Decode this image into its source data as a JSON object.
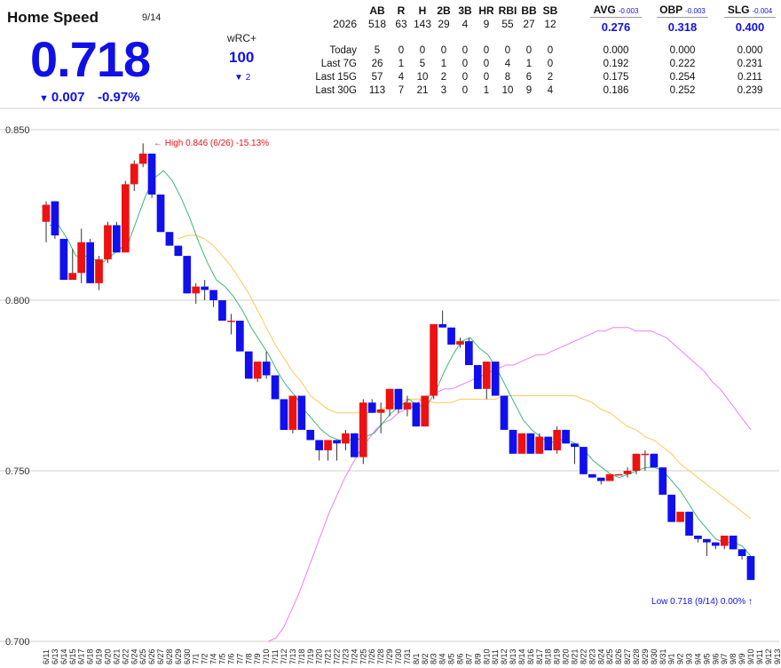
{
  "header": {
    "title": "Home Speed",
    "date": "9/14",
    "value": "0.718",
    "change": "0.007",
    "change_pct": "-0.97%",
    "wrc_label": "wRC+",
    "wrc_value": "100",
    "wrc_change": "2",
    "down_color": "#1010e6"
  },
  "stats": {
    "columns": [
      "AB",
      "R",
      "H",
      "2B",
      "3B",
      "HR",
      "RBI",
      "BB",
      "SB"
    ],
    "season_label": "2026",
    "season": [
      "518",
      "63",
      "143",
      "29",
      "4",
      "9",
      "55",
      "27",
      "12"
    ],
    "rows": [
      {
        "label": "Today",
        "values": [
          "5",
          "0",
          "0",
          "0",
          "0",
          "0",
          "0",
          "0",
          "0"
        ]
      },
      {
        "label": "Last 7G",
        "values": [
          "26",
          "1",
          "5",
          "1",
          "0",
          "0",
          "4",
          "1",
          "0"
        ]
      },
      {
        "label": "Last 15G",
        "values": [
          "57",
          "4",
          "10",
          "2",
          "0",
          "0",
          "8",
          "6",
          "2"
        ]
      },
      {
        "label": "Last 30G",
        "values": [
          "113",
          "7",
          "21",
          "3",
          "0",
          "1",
          "10",
          "9",
          "4"
        ]
      }
    ],
    "rates": [
      {
        "name": "AVG",
        "delta": "-0.003",
        "value": "0.276",
        "rows": [
          "0.000",
          "0.192",
          "0.175",
          "0.186"
        ]
      },
      {
        "name": "OBP",
        "delta": "-0.003",
        "value": "0.318",
        "rows": [
          "0.000",
          "0.222",
          "0.254",
          "0.252"
        ]
      },
      {
        "name": "SLG",
        "delta": "-0.004",
        "value": "0.400",
        "rows": [
          "0.000",
          "0.231",
          "0.211",
          "0.239"
        ]
      }
    ]
  },
  "chart_data": {
    "type": "candlestick",
    "yticks": [
      "0.850",
      "0.800",
      "0.750",
      "0.700"
    ],
    "ylim": [
      0.7,
      0.85
    ],
    "grid": true,
    "up_color": "#ee1111",
    "down_color": "#1010ee",
    "high_annotation": "← High 0.846 (6/26) -15.13%",
    "low_annotation": "Low 0.718 (9/14) 0.00% ↑",
    "annotation_colors": {
      "high": "#ee1111",
      "low": "#1010e6"
    },
    "categories": [
      "6/11",
      "6/13",
      "6/14",
      "6/15",
      "6/17",
      "6/18",
      "6/19",
      "6/20",
      "6/21",
      "6/22",
      "6/24",
      "6/25",
      "6/26",
      "6/27",
      "6/28",
      "6/29",
      "6/30",
      "7/1",
      "7/2",
      "7/4",
      "7/5",
      "7/6",
      "7/7",
      "7/8",
      "7/9",
      "7/10",
      "7/11",
      "7/12",
      "7/13",
      "7/18",
      "7/19",
      "7/20",
      "7/21",
      "7/22",
      "7/23",
      "7/24",
      "7/25",
      "7/26",
      "7/28",
      "7/29",
      "7/30",
      "7/31",
      "8/1",
      "8/2",
      "8/3",
      "8/4",
      "8/5",
      "8/6",
      "8/7",
      "8/9",
      "8/10",
      "8/11",
      "8/12",
      "8/13",
      "8/14",
      "8/16",
      "8/17",
      "8/18",
      "8/19",
      "8/20",
      "8/21",
      "8/22",
      "8/23",
      "8/24",
      "8/25",
      "8/26",
      "8/27",
      "8/28",
      "8/29",
      "8/30",
      "8/31",
      "9/1",
      "9/2",
      "9/3",
      "9/4",
      "9/5",
      "9/6",
      "9/7",
      "9/8",
      "9/9",
      "9/10",
      "9/11",
      "9/12",
      "9/13",
      "9/14"
    ],
    "candles": [
      [
        0.823,
        0.829,
        0.817,
        0.828
      ],
      [
        0.829,
        0.829,
        0.818,
        0.819
      ],
      [
        0.818,
        0.818,
        0.806,
        0.806
      ],
      [
        0.806,
        0.815,
        0.806,
        0.808
      ],
      [
        0.808,
        0.821,
        0.805,
        0.817
      ],
      [
        0.817,
        0.818,
        0.805,
        0.805
      ],
      [
        0.805,
        0.813,
        0.803,
        0.812
      ],
      [
        0.812,
        0.823,
        0.811,
        0.822
      ],
      [
        0.822,
        0.823,
        0.814,
        0.814
      ],
      [
        0.814,
        0.835,
        0.814,
        0.834
      ],
      [
        0.834,
        0.841,
        0.832,
        0.84
      ],
      [
        0.84,
        0.846,
        0.839,
        0.843
      ],
      [
        0.843,
        0.843,
        0.83,
        0.831
      ],
      [
        0.831,
        0.831,
        0.82,
        0.82
      ],
      [
        0.82,
        0.82,
        0.816,
        0.816
      ],
      [
        0.816,
        0.816,
        0.813,
        0.813
      ],
      [
        0.813,
        0.813,
        0.802,
        0.802
      ],
      [
        0.802,
        0.805,
        0.799,
        0.804
      ],
      [
        0.804,
        0.806,
        0.8,
        0.803
      ],
      [
        0.803,
        0.803,
        0.798,
        0.8
      ],
      [
        0.8,
        0.8,
        0.794,
        0.794
      ],
      [
        0.794,
        0.796,
        0.79,
        0.794
      ],
      [
        0.794,
        0.794,
        0.785,
        0.785
      ],
      [
        0.785,
        0.785,
        0.777,
        0.777
      ],
      [
        0.777,
        0.782,
        0.776,
        0.782
      ],
      [
        0.782,
        0.785,
        0.777,
        0.778
      ],
      [
        0.778,
        0.778,
        0.771,
        0.771
      ],
      [
        0.771,
        0.771,
        0.762,
        0.762
      ],
      [
        0.762,
        0.772,
        0.761,
        0.772
      ],
      [
        0.772,
        0.772,
        0.762,
        0.762
      ],
      [
        0.762,
        0.762,
        0.759,
        0.759
      ],
      [
        0.759,
        0.759,
        0.753,
        0.756
      ],
      [
        0.756,
        0.759,
        0.753,
        0.759
      ],
      [
        0.759,
        0.759,
        0.753,
        0.758
      ],
      [
        0.758,
        0.762,
        0.756,
        0.761
      ],
      [
        0.761,
        0.761,
        0.754,
        0.754
      ],
      [
        0.754,
        0.771,
        0.752,
        0.77
      ],
      [
        0.77,
        0.771,
        0.767,
        0.767
      ],
      [
        0.767,
        0.77,
        0.761,
        0.768
      ],
      [
        0.768,
        0.774,
        0.766,
        0.774
      ],
      [
        0.774,
        0.774,
        0.767,
        0.768
      ],
      [
        0.768,
        0.772,
        0.766,
        0.77
      ],
      [
        0.77,
        0.77,
        0.763,
        0.763
      ],
      [
        0.763,
        0.772,
        0.763,
        0.772
      ],
      [
        0.772,
        0.793,
        0.771,
        0.793
      ],
      [
        0.793,
        0.797,
        0.792,
        0.792
      ],
      [
        0.792,
        0.792,
        0.787,
        0.787
      ],
      [
        0.787,
        0.789,
        0.786,
        0.788
      ],
      [
        0.788,
        0.789,
        0.781,
        0.781
      ],
      [
        0.781,
        0.781,
        0.774,
        0.774
      ],
      [
        0.774,
        0.782,
        0.771,
        0.782
      ],
      [
        0.782,
        0.782,
        0.772,
        0.772
      ],
      [
        0.772,
        0.772,
        0.762,
        0.762
      ],
      [
        0.762,
        0.762,
        0.755,
        0.755
      ],
      [
        0.755,
        0.761,
        0.755,
        0.761
      ],
      [
        0.761,
        0.761,
        0.755,
        0.755
      ],
      [
        0.755,
        0.761,
        0.755,
        0.76
      ],
      [
        0.76,
        0.76,
        0.756,
        0.756
      ],
      [
        0.756,
        0.763,
        0.755,
        0.762
      ],
      [
        0.762,
        0.762,
        0.758,
        0.758
      ],
      [
        0.758,
        0.758,
        0.752,
        0.757
      ],
      [
        0.757,
        0.757,
        0.749,
        0.749
      ],
      [
        0.749,
        0.749,
        0.748,
        0.748
      ],
      [
        0.748,
        0.748,
        0.746,
        0.747
      ],
      [
        0.747,
        0.749,
        0.747,
        0.749
      ],
      [
        0.749,
        0.749,
        0.749,
        0.749
      ],
      [
        0.749,
        0.751,
        0.748,
        0.75
      ],
      [
        0.75,
        0.755,
        0.749,
        0.755
      ],
      [
        0.755,
        0.756,
        0.75,
        0.755
      ],
      [
        0.755,
        0.755,
        0.751,
        0.751
      ],
      [
        0.751,
        0.751,
        0.743,
        0.743
      ],
      [
        0.743,
        0.743,
        0.735,
        0.735
      ],
      [
        0.735,
        0.738,
        0.735,
        0.738
      ],
      [
        0.738,
        0.738,
        0.731,
        0.731
      ],
      [
        0.731,
        0.731,
        0.729,
        0.73
      ],
      [
        0.73,
        0.73,
        0.725,
        0.729
      ],
      [
        0.729,
        0.729,
        0.727,
        0.728
      ],
      [
        0.728,
        0.731,
        0.727,
        0.731
      ],
      [
        0.731,
        0.731,
        0.727,
        0.727
      ],
      [
        0.727,
        0.727,
        0.724,
        0.725
      ],
      [
        0.725,
        0.725,
        0.718,
        0.718
      ]
    ],
    "ma_short": [
      0.822,
      0.822,
      0.818,
      0.813,
      0.813,
      0.812,
      0.811,
      0.813,
      0.815,
      0.817,
      0.824,
      0.831,
      0.836,
      0.838,
      0.835,
      0.83,
      0.824,
      0.817,
      0.811,
      0.806,
      0.804,
      0.801,
      0.797,
      0.792,
      0.788,
      0.784,
      0.779,
      0.775,
      0.772,
      0.768,
      0.765,
      0.762,
      0.76,
      0.759,
      0.759,
      0.759,
      0.76,
      0.761,
      0.764,
      0.767,
      0.769,
      0.771,
      0.769,
      0.769,
      0.773,
      0.779,
      0.784,
      0.788,
      0.789,
      0.786,
      0.784,
      0.78,
      0.775,
      0.77,
      0.765,
      0.762,
      0.76,
      0.758,
      0.759,
      0.759,
      0.758,
      0.756,
      0.753,
      0.751,
      0.749,
      0.748,
      0.749,
      0.75,
      0.751,
      0.751,
      0.75,
      0.747,
      0.744,
      0.74,
      0.736,
      0.733,
      0.73,
      0.729,
      0.729,
      0.728,
      0.725
    ],
    "ma_mid": [
      null,
      null,
      null,
      null,
      null,
      null,
      null,
      null,
      null,
      null,
      null,
      null,
      null,
      null,
      null,
      0.818,
      0.819,
      0.819,
      0.818,
      0.816,
      0.813,
      0.81,
      0.806,
      0.802,
      0.797,
      0.792,
      0.787,
      0.783,
      0.779,
      0.776,
      0.772,
      0.77,
      0.768,
      0.767,
      0.767,
      0.767,
      0.767,
      0.767,
      0.768,
      0.769,
      0.77,
      0.771,
      0.771,
      0.771,
      0.77,
      0.77,
      0.77,
      0.771,
      0.771,
      0.771,
      0.771,
      0.771,
      0.772,
      0.772,
      0.772,
      0.772,
      0.772,
      0.772,
      0.772,
      0.772,
      0.772,
      0.771,
      0.77,
      0.768,
      0.767,
      0.765,
      0.763,
      0.762,
      0.76,
      0.759,
      0.757,
      0.755,
      0.752,
      0.75,
      0.748,
      0.746,
      0.744,
      0.742,
      0.74,
      0.738,
      0.736
    ],
    "ma_long": [
      null,
      null,
      null,
      null,
      null,
      null,
      null,
      null,
      null,
      null,
      null,
      null,
      null,
      null,
      null,
      null,
      null,
      null,
      null,
      null,
      null,
      null,
      null,
      null,
      null,
      null,
      null,
      null,
      null,
      0.7,
      0.701,
      0.704,
      0.709,
      0.714,
      0.72,
      0.726,
      0.732,
      0.738,
      0.743,
      0.748,
      0.752,
      0.756,
      0.759,
      0.762,
      0.764,
      0.765,
      0.767,
      0.768,
      0.769,
      0.771,
      0.772,
      0.773,
      0.774,
      0.774,
      0.775,
      0.776,
      0.777,
      0.778,
      0.779,
      0.78,
      0.781,
      0.781,
      0.782,
      0.783,
      0.784,
      0.784,
      0.785,
      0.786,
      0.787,
      0.788,
      0.789,
      0.79,
      0.791,
      0.791,
      0.792,
      0.792,
      0.792,
      0.791,
      0.791,
      0.791,
      0.79,
      0.789,
      0.787,
      0.785,
      0.783,
      0.781,
      0.779,
      0.776,
      0.774,
      0.771,
      0.768,
      0.765,
      0.762
    ]
  }
}
